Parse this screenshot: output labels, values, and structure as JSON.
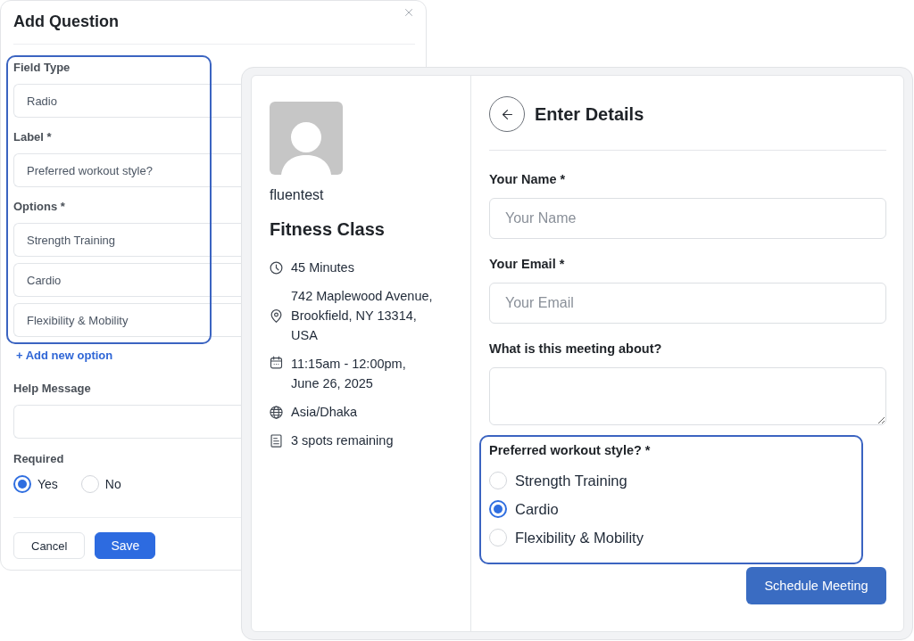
{
  "add_question_dialog": {
    "title": "Add Question",
    "fields": [
      {
        "label": "Field Type",
        "values": [
          "Radio"
        ]
      },
      {
        "label": "Label *",
        "values": [
          "Preferred workout style?"
        ]
      },
      {
        "label": "Options *",
        "values": [
          "Strength Training",
          "Cardio",
          "Flexibility & Mobility"
        ]
      }
    ],
    "add_option_link": "+ Add new option",
    "help_message": {
      "label": "Help Message"
    },
    "required": {
      "label": "Required",
      "choices": [
        {
          "label": "Yes",
          "selected": true
        },
        {
          "label": "No",
          "selected": false
        }
      ]
    },
    "buttons": [
      {
        "label": "Cancel",
        "kind": "secondary"
      },
      {
        "label": "Save",
        "kind": "primary"
      }
    ]
  },
  "booking_panel": {
    "host": "fluentest",
    "event_title": "Fitness Class",
    "details": [
      {
        "kind": "duration",
        "lines": [
          "45 Minutes"
        ]
      },
      {
        "kind": "location",
        "lines": [
          "742 Maplewood Avenue,",
          "Brookfield, NY 13314,",
          "USA"
        ]
      },
      {
        "kind": "date",
        "lines": [
          "11:15am - 12:00pm,",
          "June 26, 2025"
        ]
      },
      {
        "kind": "timezone",
        "lines": [
          "Asia/Dhaka"
        ]
      },
      {
        "kind": "spots",
        "lines": [
          "3 spots remaining"
        ]
      }
    ],
    "form": {
      "title": "Enter Details",
      "fields": [
        {
          "kind": "input",
          "label": "Your Name *",
          "placeholder": "Your Name"
        },
        {
          "kind": "input",
          "label": "Your Email *",
          "placeholder": "Your Email"
        },
        {
          "kind": "textarea",
          "label": "What is this meeting about?"
        }
      ],
      "choice_question": {
        "label": "Preferred workout style? *",
        "options": [
          {
            "label": "Strength Training",
            "selected": false
          },
          {
            "label": "Cardio",
            "selected": true
          },
          {
            "label": "Flexibility & Mobility",
            "selected": false
          }
        ]
      },
      "submit_button": "Schedule Meeting"
    }
  }
}
